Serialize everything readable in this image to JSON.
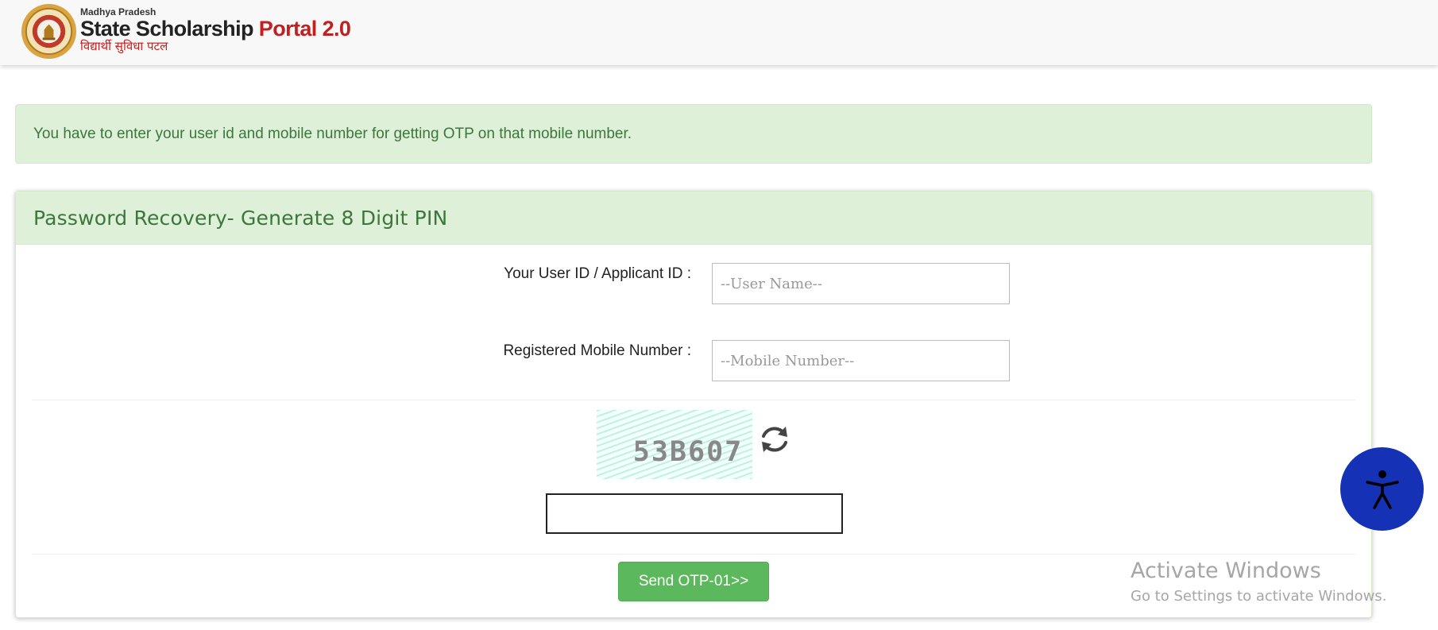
{
  "header": {
    "logo_state": "Madhya Pradesh",
    "logo_title": "State Scholarship",
    "logo_portal": "Portal 2.0",
    "logo_hindi": "विद्यार्थी सुविधा पटल"
  },
  "alert": {
    "message": "You have to enter your user id and mobile number for getting OTP on that mobile number."
  },
  "panel": {
    "title": "Password Recovery- Generate 8 Digit PIN",
    "user_id_label": "Your User ID / Applicant ID :",
    "user_id_placeholder": "--User Name--",
    "user_id_value": "",
    "mobile_label": "Registered Mobile Number :",
    "mobile_placeholder": "--Mobile Number--",
    "mobile_value": "",
    "captcha_text": "53B607",
    "captcha_input_value": "",
    "send_button": "Send OTP-01>>"
  },
  "icons": {
    "refresh": "refresh-icon",
    "accessibility": "accessibility-icon"
  },
  "watermark": {
    "title": "Activate Windows",
    "subtitle": "Go to Settings to activate Windows."
  },
  "colors": {
    "alert_bg": "#dff0d8",
    "alert_text": "#3c763d",
    "button": "#5cb85c",
    "accessibility": "#1531b5",
    "brand_red": "#c0201f"
  }
}
